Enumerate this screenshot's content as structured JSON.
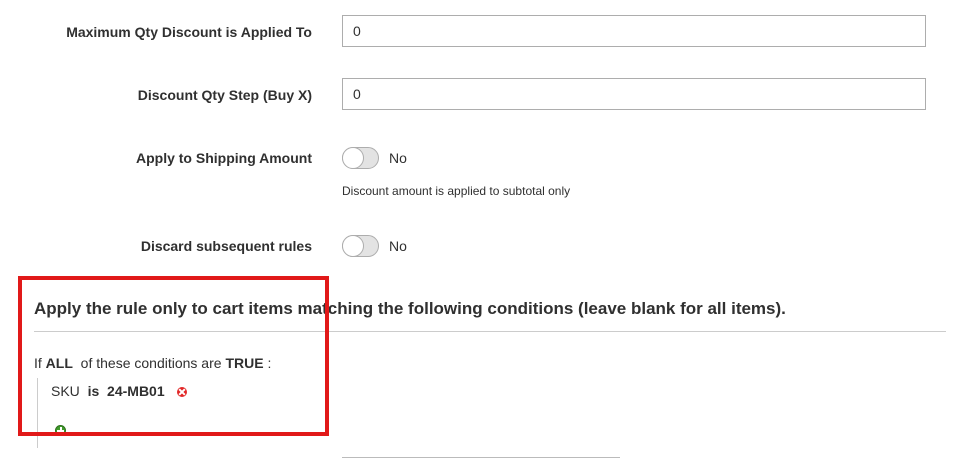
{
  "fields": {
    "max_qty": {
      "label": "Maximum Qty Discount is Applied To",
      "value": "0"
    },
    "qty_step": {
      "label": "Discount Qty Step (Buy X)",
      "value": "0"
    },
    "apply_shipping": {
      "label": "Apply to Shipping Amount",
      "state": "No",
      "note": "Discount amount is applied to subtotal only"
    },
    "discard_rules": {
      "label": "Discard subsequent rules",
      "state": "No"
    }
  },
  "conditions": {
    "title": "Apply the rule only to cart items matching the following conditions (leave blank for all items).",
    "if_text": "If",
    "aggregator": "ALL",
    "middle_text": "of these conditions are",
    "value": "TRUE",
    "colon": ":",
    "rule": {
      "attribute": "SKU",
      "operator": "is",
      "value": "24-MB01"
    }
  },
  "icons": {
    "remove": "remove-condition-icon",
    "add": "add-condition-icon"
  },
  "colors": {
    "highlight": "#e11919",
    "remove": "#e22626",
    "add": "#3f9b2a"
  }
}
